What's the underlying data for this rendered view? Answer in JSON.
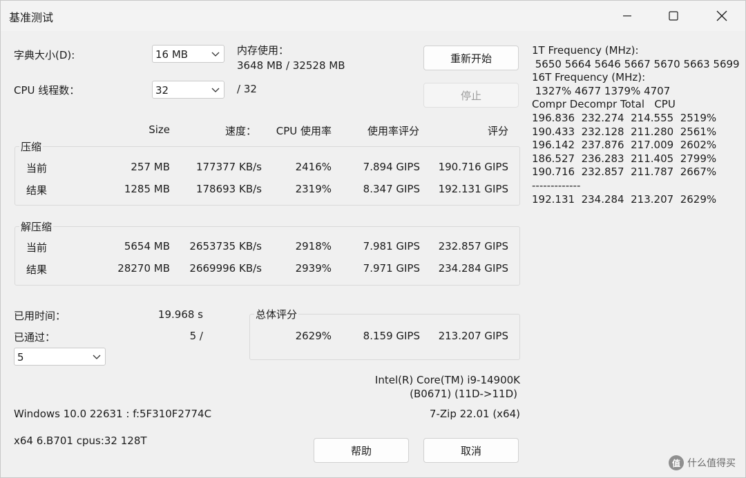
{
  "window": {
    "title": "基准测试"
  },
  "dict": {
    "label": "字典大小(D):",
    "value": "16 MB"
  },
  "memory": {
    "label": "内存使用：",
    "value": "3648 MB / 32528 MB"
  },
  "threads": {
    "label": "CPU 线程数：",
    "value": "32",
    "max": "/ 32"
  },
  "buttons": {
    "restart": "重新开始",
    "stop": "停止",
    "help": "帮助",
    "cancel": "取消"
  },
  "columns": {
    "size": "Size",
    "speed": "速度：",
    "cpu": "CPU 使用率",
    "rating_usage": "使用率评分",
    "rating": "评分"
  },
  "compress": {
    "legend": "压缩",
    "rows": [
      {
        "label": "当前",
        "size": "257 MB",
        "speed": "177377 KB/s",
        "cpu": "2416%",
        "rating_usage": "7.894 GIPS",
        "rating": "190.716 GIPS"
      },
      {
        "label": "结果",
        "size": "1285 MB",
        "speed": "178693 KB/s",
        "cpu": "2319%",
        "rating_usage": "8.347 GIPS",
        "rating": "192.131 GIPS"
      }
    ]
  },
  "decompress": {
    "legend": "解压缩",
    "rows": [
      {
        "label": "当前",
        "size": "5654 MB",
        "speed": "2653735 KB/s",
        "cpu": "2918%",
        "rating_usage": "7.981 GIPS",
        "rating": "232.857 GIPS"
      },
      {
        "label": "结果",
        "size": "28270 MB",
        "speed": "2669996 KB/s",
        "cpu": "2939%",
        "rating_usage": "7.971 GIPS",
        "rating": "234.284 GIPS"
      }
    ]
  },
  "elapsed": {
    "label": "已用时间：",
    "value": "19.968 s"
  },
  "passes": {
    "label": "已通过：",
    "value": "5 /",
    "select": "5"
  },
  "total": {
    "legend": "总体评分",
    "cpu": "2629%",
    "rating_usage": "8.159 GIPS",
    "rating": "213.207 GIPS"
  },
  "cpu_info": {
    "line1": "Intel(R) Core(TM) i9-14900K",
    "line2": "(B0671) (11D->11D)"
  },
  "os_info": "Windows 10.0 22631 :  f:5F310F2774C",
  "zip_version": "7-Zip 22.01 (x64)",
  "arch_info": "x64 6.B701 cpus:32 128T",
  "right_panel": [
    "1T Frequency (MHz):",
    " 5650 5664 5646 5667 5670 5663 5699",
    "16T Frequency (MHz):",
    " 1327% 4677 1379% 4707",
    "Compr Decompr Total   CPU",
    "196.836  232.274  214.555  2519%",
    "190.433  232.128  211.280  2561%",
    "196.142  237.876  217.009  2602%",
    "186.527  236.283  211.405  2799%",
    "190.716  232.857  211.787  2667%",
    "-------------",
    "192.131  234.284  213.207  2629%"
  ],
  "watermark": {
    "badge": "值",
    "text": "什么值得买"
  }
}
